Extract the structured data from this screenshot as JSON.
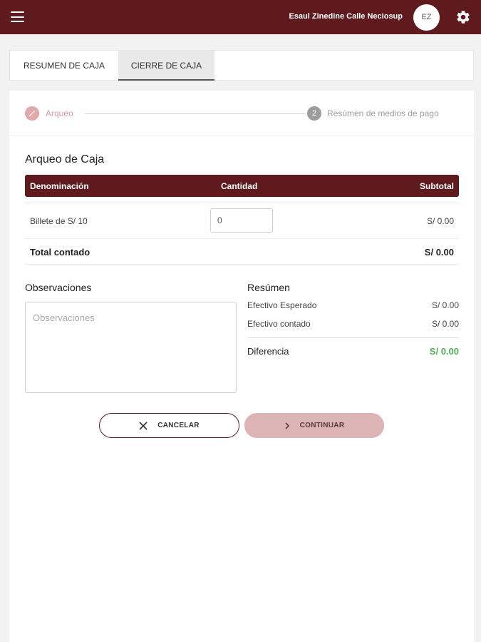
{
  "header": {
    "user_name": "Esaul Zinedine Calle Neciosup",
    "avatar_initials": "EZ",
    "background": "#5e1a1c",
    "icons": [
      "menu-icon",
      "gear-icon"
    ]
  },
  "tabs": [
    {
      "label": "RESUMEN DE CAJA",
      "active": false
    },
    {
      "label": "CIERRE DE CAJA",
      "active": true
    }
  ],
  "stepper": {
    "step1_label": "Arqueo",
    "step1_icon": "pencil-icon",
    "step2_number": "2",
    "step2_label": "Resúmen de medios de pago"
  },
  "arqueo": {
    "title": "Arqueo de Caja",
    "columns": [
      "Denominación",
      "Cantidad",
      "Subtotal"
    ],
    "rows": [
      {
        "denominacion": "Billete de S/ 10",
        "cantidad": "0",
        "subtotal": "S/ 0.00"
      }
    ],
    "total_label": "Total contado",
    "total_value": "S/ 0.00"
  },
  "observaciones": {
    "title": "Observaciones",
    "placeholder": "Observaciones"
  },
  "resumen": {
    "title": "Resúmen",
    "esperado_label": "Efectivo Esperado",
    "esperado_value": "S/ 0.00",
    "contado_label": "Efectivo contado",
    "contado_value": "S/ 0.00",
    "diferencia_label": "Diferencia",
    "diferencia_value": "S/ 0.00",
    "diferencia_color": "#4caf50"
  },
  "actions": {
    "cancel_label": "CANCELAR",
    "cancel_icon": "close-icon",
    "continue_label": "CONTINUAR",
    "continue_icon": "chevron-right-icon"
  }
}
